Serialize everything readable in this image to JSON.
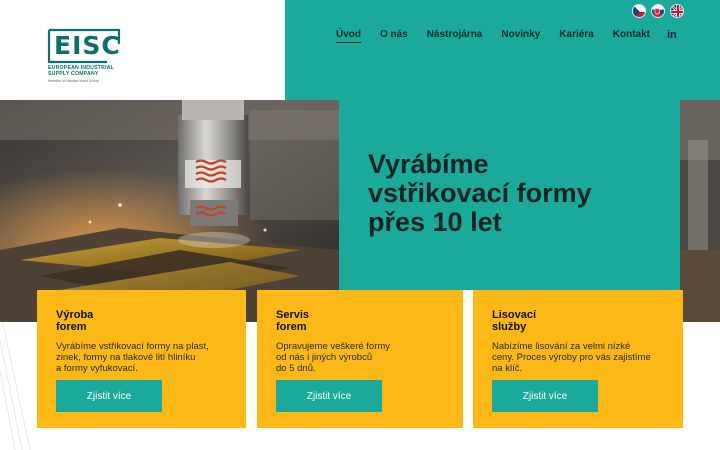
{
  "logo": {
    "letters": "EISC",
    "company_line1": "EUROPEAN INDUSTRIAL",
    "company_line2": "SUPPLY COMPANY",
    "member": "Member of Nautica Ward Group"
  },
  "languages": [
    {
      "icon": "flag-cz-icon"
    },
    {
      "icon": "flag-sk-icon"
    },
    {
      "icon": "flag-uk-icon"
    }
  ],
  "nav": {
    "items": [
      "Úvod",
      "O nás",
      "Nástrojárna",
      "Novinky",
      "Kariéra",
      "Kontakt"
    ],
    "active": "Úvod",
    "linkedin_label": "in"
  },
  "hero": {
    "title_line1": "Vyrábíme",
    "title_line2": "vstřikovací formy",
    "title_line3": "přes 10 let"
  },
  "cards": [
    {
      "title_line1": "Výroba",
      "title_line2": "forem",
      "text_line1": "Vyrábíme vstřikovací formy na plast,",
      "text_line2": "zinek, formy na tlakové lití hliníku",
      "text_line3": "a formy vyfukovací.",
      "button": "Zjistit více"
    },
    {
      "title_line1": "Servis",
      "title_line2": "forem",
      "text_line1": "Opravujeme veškeré formy",
      "text_line2": "od nás i jiných výrobců",
      "text_line3": "do 5 dnů.",
      "button": "Zjistit více"
    },
    {
      "title_line1": "Lisovací",
      "title_line2": "služby",
      "text_line1": "Nabízíme lisování za velmi nízké",
      "text_line2": "ceny. Proces výroby pro vás zajistíme",
      "text_line3": "na klíč.",
      "button": "Zjistit více"
    }
  ],
  "colors": {
    "teal": "#1ba99b",
    "yellow": "#fbb817",
    "dark_text": "#0f2523"
  }
}
